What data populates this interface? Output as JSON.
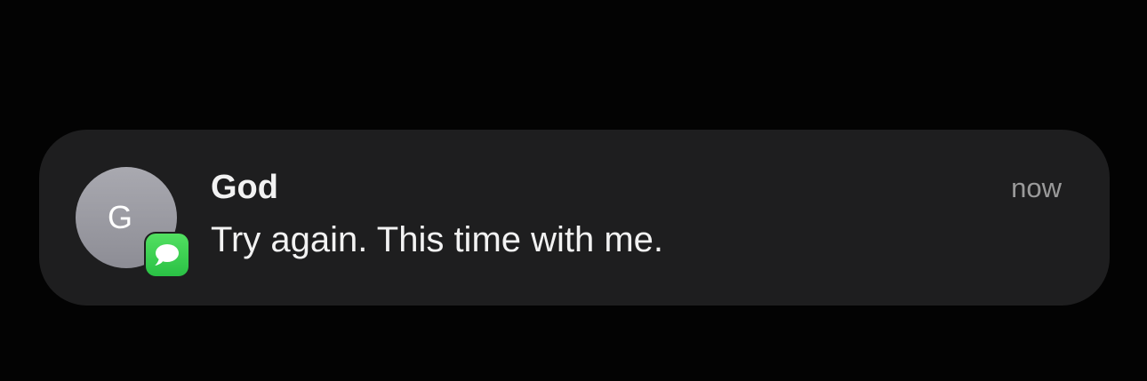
{
  "notification": {
    "avatar_initial": "G",
    "app_icon": "messages-icon",
    "sender": "God",
    "message": "Try again. This time with me.",
    "time": "now"
  },
  "colors": {
    "background": "#030303",
    "card": "#1e1e1f",
    "avatar": "#9b9ba2",
    "messages_green": "#34c759",
    "primary_text": "#f2f2f2",
    "secondary_text": "#9a9a9a"
  }
}
